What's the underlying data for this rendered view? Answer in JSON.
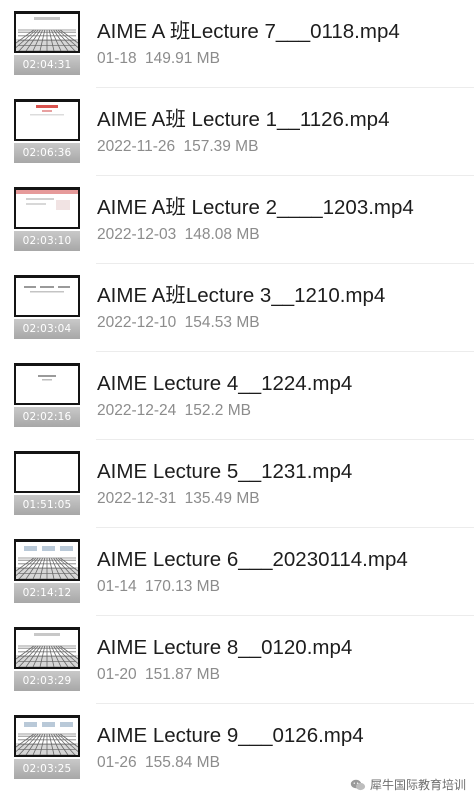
{
  "videos": [
    {
      "title": "AIME A 班Lecture 7___0118.mp4",
      "date": "01-18",
      "size": "149.91 MB",
      "duration": "02:04:31",
      "thumb": "grid"
    },
    {
      "title": "AIME A班 Lecture 1__1126.mp4",
      "date": "2022-11-26",
      "size": "157.39 MB",
      "duration": "02:06:36",
      "thumb": "slide-red"
    },
    {
      "title": "AIME A班 Lecture 2____1203.mp4",
      "date": "2022-12-03",
      "size": "148.08 MB",
      "duration": "02:03:10",
      "thumb": "slide-pink"
    },
    {
      "title": "AIME A班Lecture 3__1210.mp4",
      "date": "2022-12-10",
      "size": "154.53 MB",
      "duration": "02:03:04",
      "thumb": "slide-text"
    },
    {
      "title": "AIME Lecture 4__1224.mp4",
      "date": "2022-12-24",
      "size": "152.2 MB",
      "duration": "02:02:16",
      "thumb": "slide-small"
    },
    {
      "title": "AIME Lecture 5__1231.mp4",
      "date": "2022-12-31",
      "size": "135.49 MB",
      "duration": "01:51:05",
      "thumb": "blank"
    },
    {
      "title": "AIME Lecture 6___20230114.mp4",
      "date": "01-14",
      "size": "170.13 MB",
      "duration": "02:14:12",
      "thumb": "grid-boxes"
    },
    {
      "title": "AIME Lecture 8__0120.mp4",
      "date": "01-20",
      "size": "151.87 MB",
      "duration": "02:03:29",
      "thumb": "grid"
    },
    {
      "title": "AIME Lecture 9___0126.mp4",
      "date": "01-26",
      "size": "155.84 MB",
      "duration": "02:03:25",
      "thumb": "grid-boxes"
    }
  ],
  "watermark": {
    "text": "犀牛国际教育培训",
    "icon": "wechat-icon"
  }
}
